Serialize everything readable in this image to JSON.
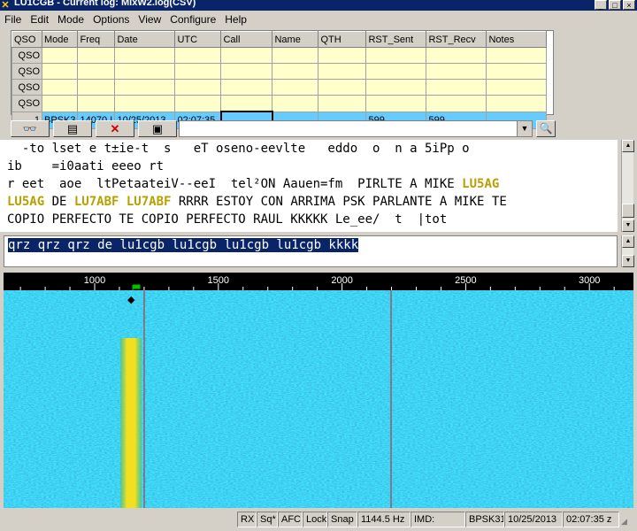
{
  "window": {
    "title": "LU1CGB - Current log: MixW2.log(CSV)"
  },
  "menu": [
    "File",
    "Edit",
    "Mode",
    "Options",
    "View",
    "Configure",
    "Help"
  ],
  "log": {
    "columns": [
      "QSO",
      "Mode",
      "Freq",
      "Date",
      "UTC",
      "Call",
      "Name",
      "QTH",
      "RST_Sent",
      "RST_Recv",
      "Notes"
    ],
    "rows": [
      [
        "QSO",
        "",
        "",
        "",
        "",
        "",
        "",
        "",
        "",
        "",
        ""
      ],
      [
        "QSO",
        "",
        "",
        "",
        "",
        "",
        "",
        "",
        "",
        "",
        ""
      ],
      [
        "QSO",
        "",
        "",
        "",
        "",
        "",
        "",
        "",
        "",
        "",
        ""
      ],
      [
        "QSO",
        "",
        "",
        "",
        "",
        "",
        "",
        "",
        "",
        "",
        ""
      ],
      [
        "1",
        "BPSK3",
        "14070.I",
        "10/25/2013",
        "02:07:35",
        "",
        "",
        "",
        "599",
        "599",
        ""
      ]
    ]
  },
  "rx": {
    "lines": [
      [
        {
          "t": "  -to lset e t±ie-t  s   eT oseno-eevlte   eddo  o  n a 5iPp o"
        }
      ],
      [
        {
          "t": "ib    =i0aati eeeo rt"
        }
      ],
      [
        {
          "t": "r eet  aoe  ltPetaateiV--eeI  tel²ON Aauen=fm  PIRLTE A MIKE "
        },
        {
          "t": "LU5AG",
          "hl": true
        }
      ],
      [
        {
          "t": "LU5AG",
          "hl": true
        },
        {
          "t": " DE "
        },
        {
          "t": "LU7ABF LU7ABF",
          "hl": true
        },
        {
          "t": " RRRR ESTOY CON ARRIMA PSK PARLANTE A MIKE TE"
        }
      ],
      [
        {
          "t": "COPIO PERFECTO TE COPIO PERFECTO RAUL KKKKK Le_ee/  t  |tot"
        }
      ]
    ]
  },
  "tx": {
    "text": "qrz qrz qrz de lu1cgb lu1cgb lu1cgb lu1cgb kkkk"
  },
  "ruler": {
    "ticks": [
      "1000",
      "1500",
      "2000",
      "2500",
      "3000"
    ]
  },
  "status": {
    "rx": "RX",
    "sq": "Sq*",
    "afc": "AFC",
    "lock": "Lock",
    "snap": "Snap",
    "freq": "1144.5 Hz",
    "imd": "IMD:",
    "mode": "BPSK31",
    "date": "10/25/2013",
    "time": "02:07:35 z"
  },
  "colors": {
    "highlight": "#b8a000",
    "waterfall_base": "#2a7fc0",
    "signal": "#f0e020"
  }
}
